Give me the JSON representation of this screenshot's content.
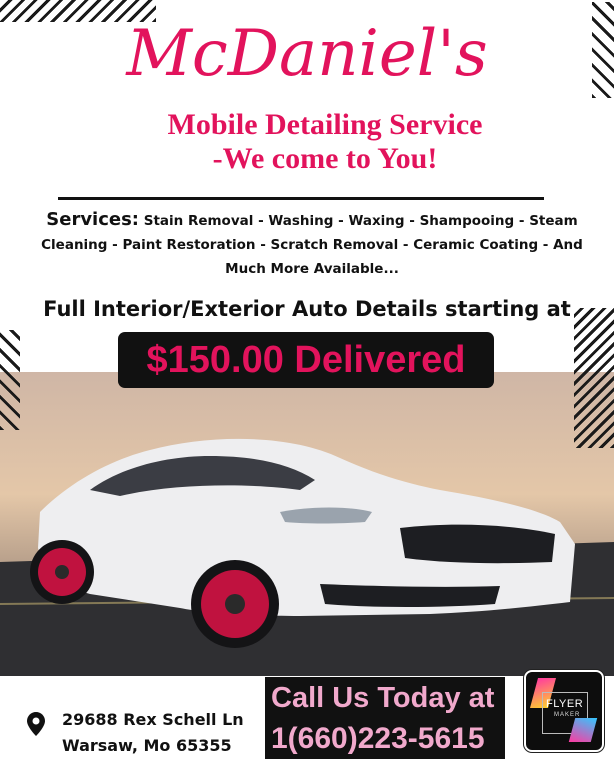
{
  "header": {
    "title": "McDaniel's",
    "subtitle_line1": "Mobile Detailing Service",
    "subtitle_line2": "-We come to You!"
  },
  "services": {
    "label": "Services:",
    "text": "Stain Removal - Washing - Waxing - Shampooing - Steam Cleaning - Paint Restoration - Scratch Removal - Ceramic Coating - And Much More Available..."
  },
  "offer": {
    "text": "Full Interior/Exterior Auto Details starting at",
    "price": "$150.00 Delivered"
  },
  "contact": {
    "address_line1": "29688 Rex Schell Ln",
    "address_line2": "Warsaw, Mo 65355",
    "call_line1": "Call Us Today at",
    "call_line2": "1(660)223-5615"
  },
  "badge": {
    "brand_line1": "FLYER",
    "brand_line2": "MAKER"
  },
  "colors": {
    "accent": "#e2135c",
    "cta_text": "#f1a9cc",
    "dark": "#111111"
  },
  "icons": {
    "address": "map-pin-icon"
  }
}
